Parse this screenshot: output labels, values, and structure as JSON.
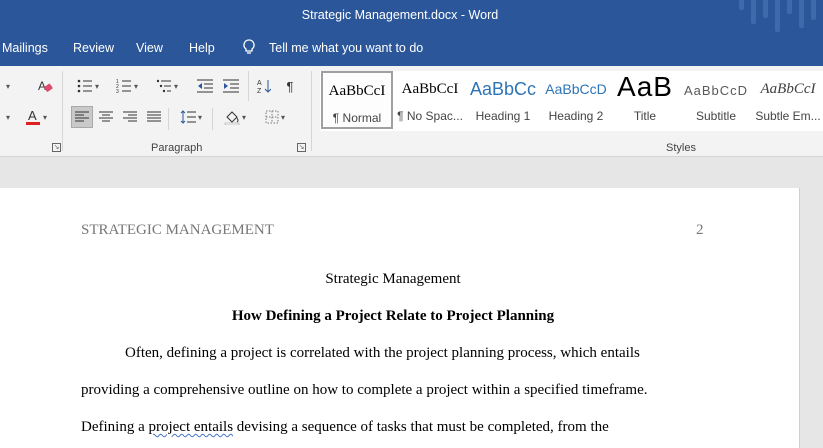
{
  "window": {
    "title": "Strategic Management.docx  -  Word"
  },
  "menu": {
    "mailings": "Mailings",
    "review": "Review",
    "view": "View",
    "help": "Help",
    "tell_me": "Tell me what you want to do"
  },
  "ribbon": {
    "paragraph_label": "Paragraph",
    "styles_label": "Styles",
    "styles": [
      {
        "sample": "AaBbCcI",
        "name": "¶ Normal"
      },
      {
        "sample": "AaBbCcI",
        "name": "¶ No Spac..."
      },
      {
        "sample": "AaBbCc",
        "name": "Heading 1"
      },
      {
        "sample": "AaBbCcD",
        "name": "Heading 2"
      },
      {
        "sample": "AaB",
        "name": "Title"
      },
      {
        "sample": "AaBbCcD",
        "name": "Subtitle"
      },
      {
        "sample": "AaBbCcI",
        "name": "Subtle Em..."
      }
    ]
  },
  "document": {
    "header_left": "STRATEGIC MANAGEMENT",
    "header_page": "2",
    "title": "Strategic Management",
    "heading": "How Defining a Project Relate to Project Planning",
    "lines": [
      "Often, defining a project is correlated with the project planning process, which entails",
      "providing a comprehensive outline on how to complete a project within a specified timeframe."
    ],
    "line3_a": "Defining a ",
    "line3_b": "project entails",
    "line3_c": " devising a sequence of tasks that must be completed, from the"
  }
}
